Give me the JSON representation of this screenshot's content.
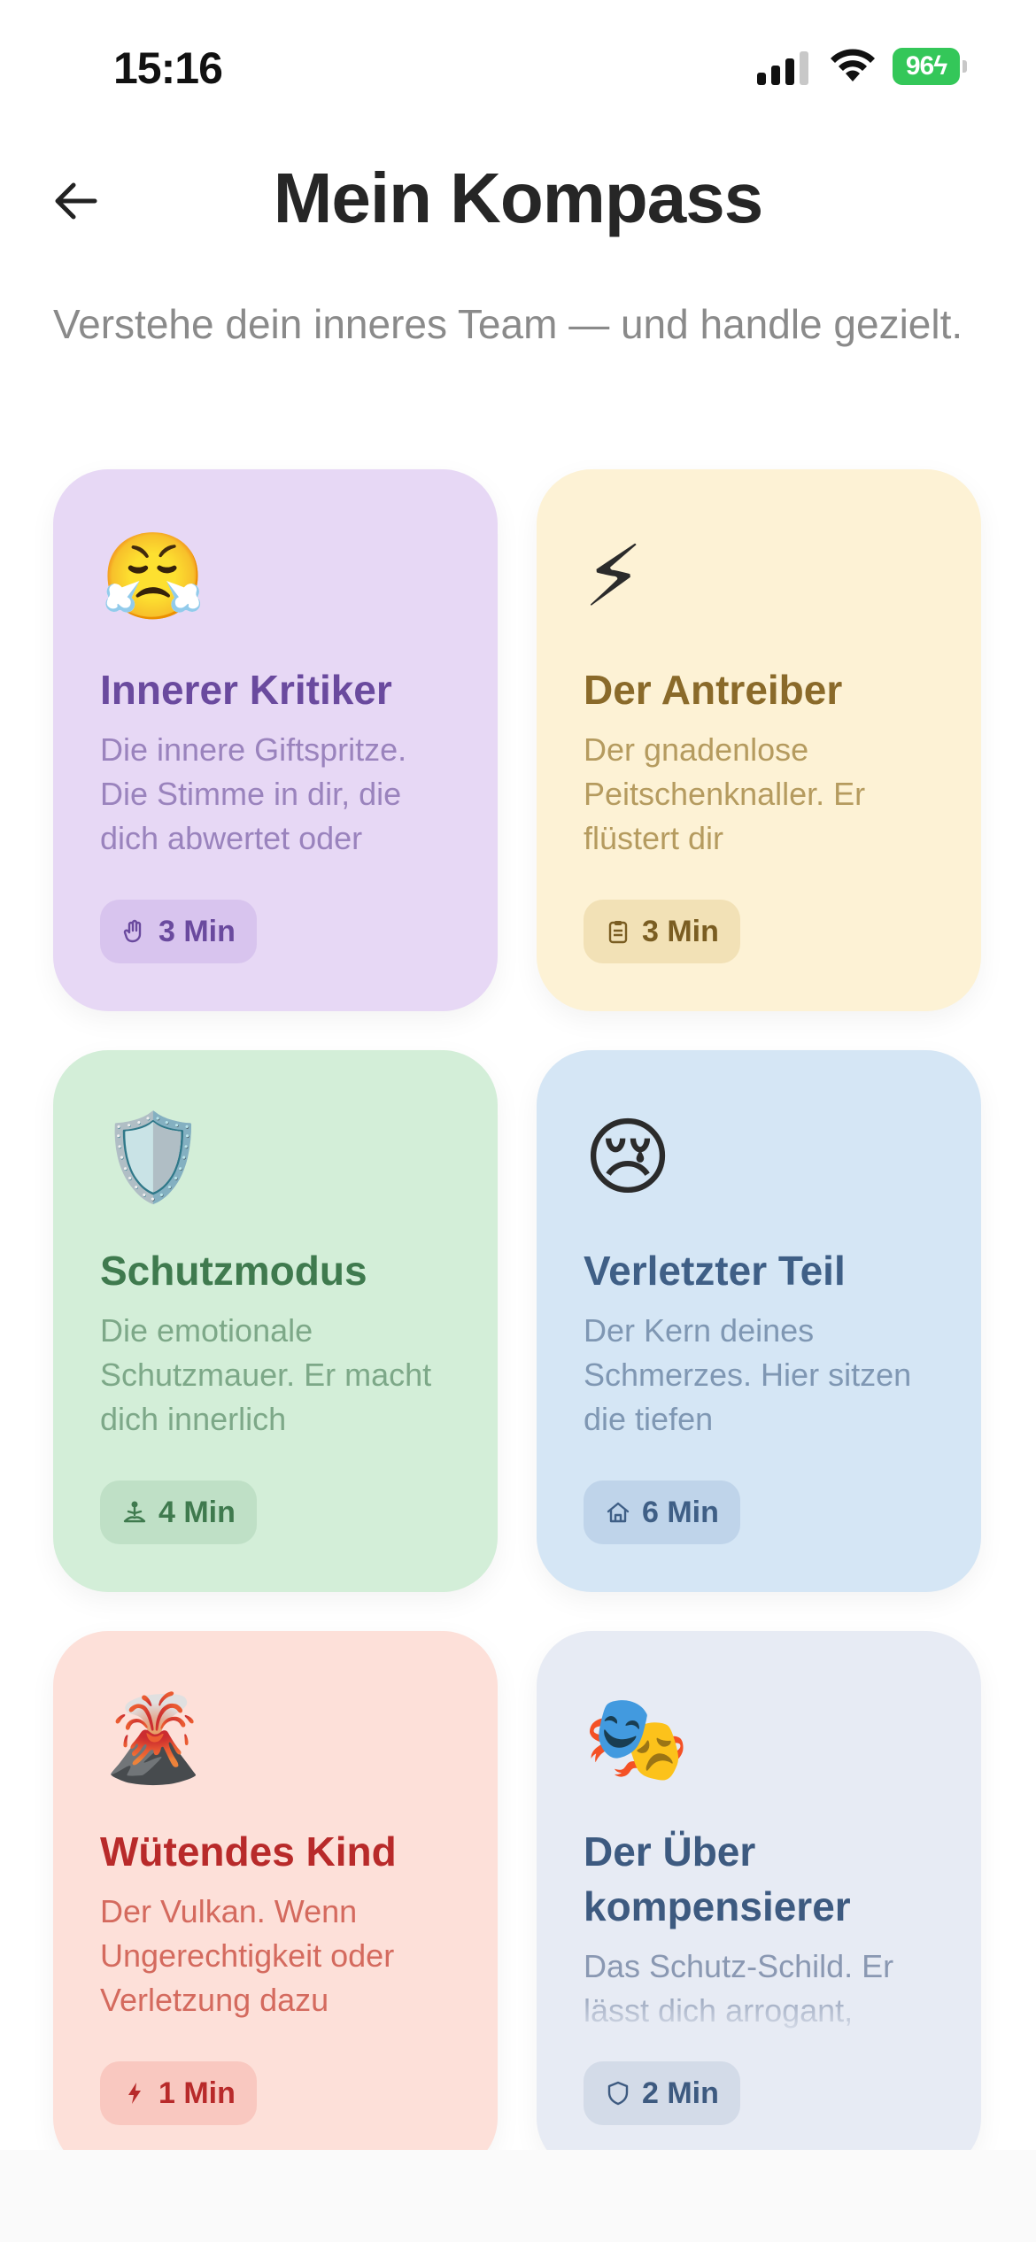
{
  "status_bar": {
    "time": "15:16",
    "battery": "96"
  },
  "header": {
    "title": "Mein Kompass",
    "subtitle": "Verstehe dein inneres Team — und handle gezielt."
  },
  "cards": [
    {
      "emoji": "😤",
      "title": "Innerer Kritiker",
      "description": "Die innere Giftspritze. Die Stimme in dir, die dich abwertet oder",
      "chip_icon": "hand-icon",
      "chip_label": "3 Min"
    },
    {
      "emoji": "⚡",
      "title": "Der Antreiber",
      "description": "Der gnadenlose Peitschenknaller. Er flüstert dir",
      "chip_icon": "clipboard-icon",
      "chip_label": "3 Min"
    },
    {
      "emoji": "🛡️",
      "title": "Schutzmodus",
      "description": "Die emotionale Schutzmauer. Er macht dich innerlich",
      "chip_icon": "meditation-icon",
      "chip_label": "4 Min"
    },
    {
      "emoji": "😢",
      "title": "Verletzter Teil",
      "description": "Der Kern deines Schmerzes. Hier sitzen die tiefen",
      "chip_icon": "home-icon",
      "chip_label": "6 Min"
    },
    {
      "emoji": "🌋",
      "title": "Wütendes Kind",
      "description": "Der Vulkan. Wenn Ungerechtigkeit oder Verletzung dazu",
      "chip_icon": "lightning-icon",
      "chip_label": "1 Min"
    },
    {
      "emoji": "🎭",
      "title": "Der Über kompensierer",
      "description": "Das Schutz-Schild. Er lässt dich arrogant,",
      "chip_icon": "shield-icon",
      "chip_label": "2 Min"
    }
  ]
}
